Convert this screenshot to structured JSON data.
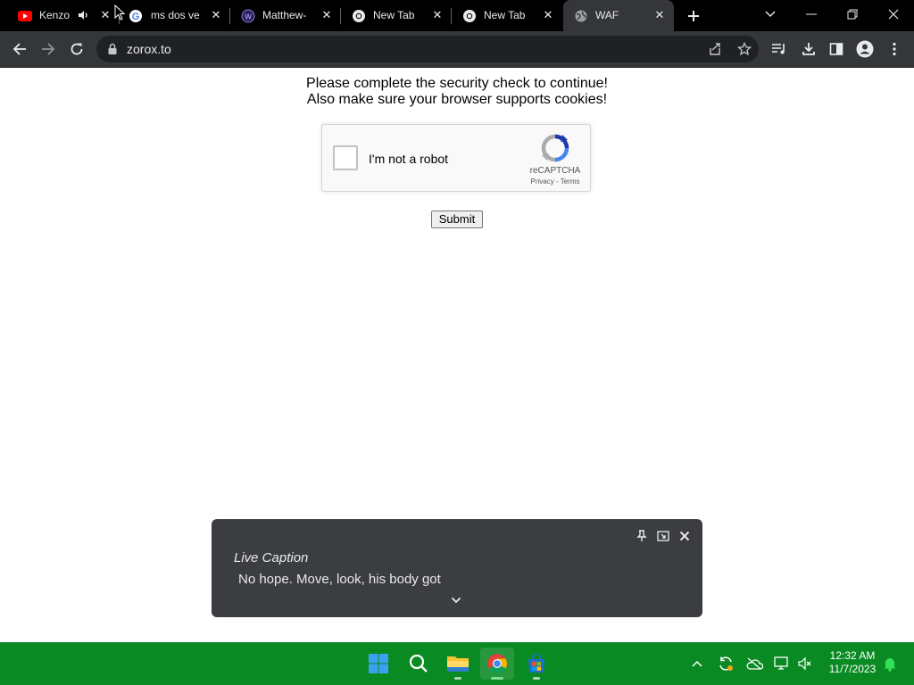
{
  "browser": {
    "tabs": [
      {
        "title": "Kenzo",
        "favicon": "youtube-icon",
        "audio": true,
        "active": false
      },
      {
        "title": "ms dos ve",
        "favicon": "google-icon",
        "active": false
      },
      {
        "title": "Matthew-",
        "favicon": "site-icon",
        "active": false
      },
      {
        "title": "New Tab",
        "favicon": "chrome-icon",
        "active": false
      },
      {
        "title": "New Tab",
        "favicon": "chrome-icon",
        "active": false
      },
      {
        "title": "WAF",
        "favicon": "globe-icon",
        "active": true
      }
    ],
    "address": "zorox.to"
  },
  "page": {
    "line1": "Please complete the security check to continue!",
    "line2": "Also make sure your browser supports cookies!",
    "recaptcha": {
      "label": "I'm not a robot",
      "brand": "reCAPTCHA",
      "privacy": "Privacy",
      "separator": "-",
      "terms": "Terms"
    },
    "submit_label": "Submit"
  },
  "live_caption": {
    "title": "Live Caption",
    "text": "No hope. Move, look, his body got"
  },
  "taskbar": {
    "time": "12:32 AM",
    "date": "11/7/2023"
  },
  "colors": {
    "tabstrip": "#000000",
    "toolbar": "#35363a",
    "taskbar": "#0a8a23",
    "caption_bg": "#3c3d40"
  }
}
